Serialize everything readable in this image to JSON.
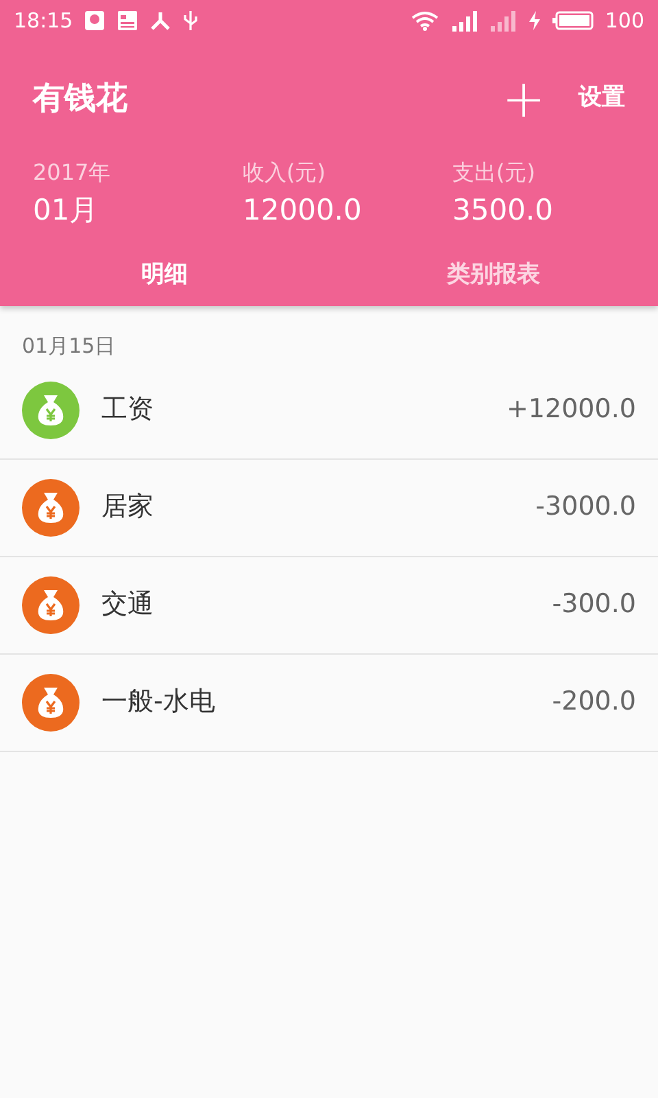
{
  "status_bar": {
    "time": "18:15",
    "battery": "100"
  },
  "app_bar": {
    "title": "有钱花",
    "add": "+",
    "settings": "设置"
  },
  "summary": [
    {
      "label": "2017年",
      "value": "01月"
    },
    {
      "label": "收入(元)",
      "value": "12000.0"
    },
    {
      "label": "支出(元)",
      "value": "3500.0"
    }
  ],
  "tabs": [
    {
      "label": "明细",
      "selected": true
    },
    {
      "label": "类别报表",
      "selected": false
    }
  ],
  "date_header": "01月15日",
  "entries": [
    {
      "category": "工资",
      "amount": "+12000.0",
      "color": "#7dc73f"
    },
    {
      "category": "居家",
      "amount": "-3000.0",
      "color": "#ec6a1f"
    },
    {
      "category": "交通",
      "amount": "-300.0",
      "color": "#ec6a1f"
    },
    {
      "category": "一般-水电",
      "amount": "-200.0",
      "color": "#ec6a1f"
    }
  ]
}
